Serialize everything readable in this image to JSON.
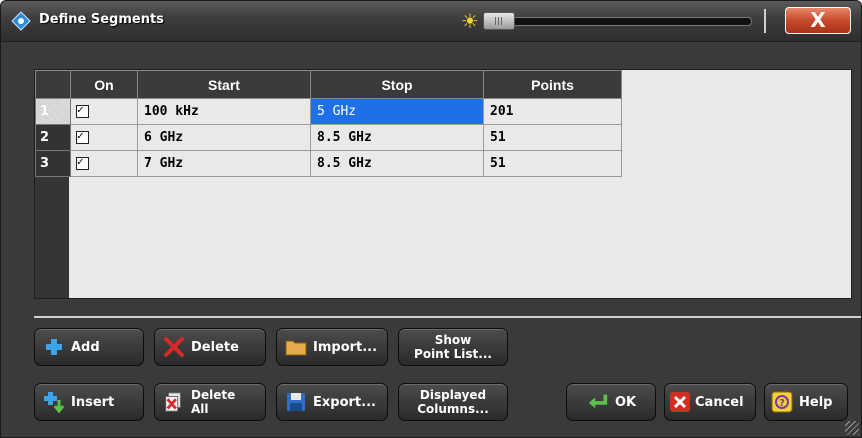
{
  "window": {
    "title": "Define Segments",
    "close_label": "X"
  },
  "table": {
    "columns": [
      "On",
      "Start",
      "Stop",
      "Points"
    ],
    "rows": [
      {
        "num": "1",
        "on": true,
        "start": "100 kHz",
        "stop": "5 GHz",
        "points": "201"
      },
      {
        "num": "2",
        "on": true,
        "start": "6 GHz",
        "stop": "8.5 GHz",
        "points": "51"
      },
      {
        "num": "3",
        "on": true,
        "start": "7 GHz",
        "stop": "8.5 GHz",
        "points": "51"
      }
    ]
  },
  "buttons": {
    "add": "Add",
    "delete": "Delete",
    "import": "Import...",
    "show_point_list_1": "Show",
    "show_point_list_2": "Point List...",
    "insert": "Insert",
    "delete_all_1": "Delete",
    "delete_all_2": "All",
    "export": "Export...",
    "displayed_columns_1": "Displayed",
    "displayed_columns_2": "Columns...",
    "ok": "OK",
    "cancel": "Cancel",
    "help": "Help"
  },
  "colors": {
    "selection": "#1f6fe8",
    "close_red": "#c6492a",
    "dialog_bg": "#3a3a3a"
  }
}
